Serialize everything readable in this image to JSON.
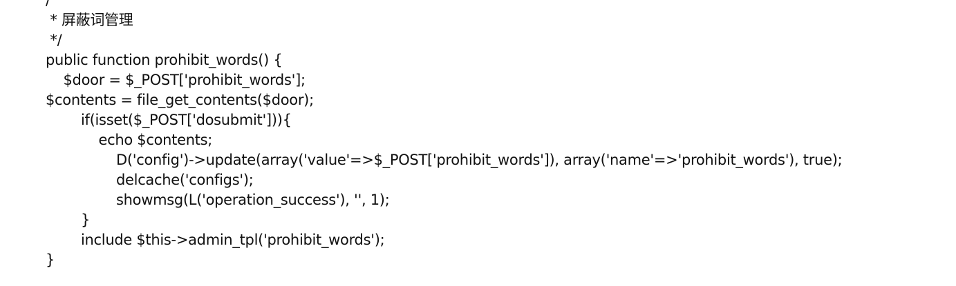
{
  "code_lines": [
    "/",
    " * 屏蔽词管理",
    " */",
    "public function prohibit_words() {",
    "    $door = $_POST['prohibit_words'];",
    "$contents = file_get_contents($door);",
    "        if(isset($_POST['dosubmit'])){",
    "            echo $contents;",
    "                D('config')->update(array('value'=>$_POST['prohibit_words']), array('name'=>'prohibit_words'), true);",
    "                delcache('configs');",
    "                showmsg(L('operation_success'), '', 1);",
    "        }",
    "        include $this->admin_tpl('prohibit_words');",
    "}"
  ]
}
